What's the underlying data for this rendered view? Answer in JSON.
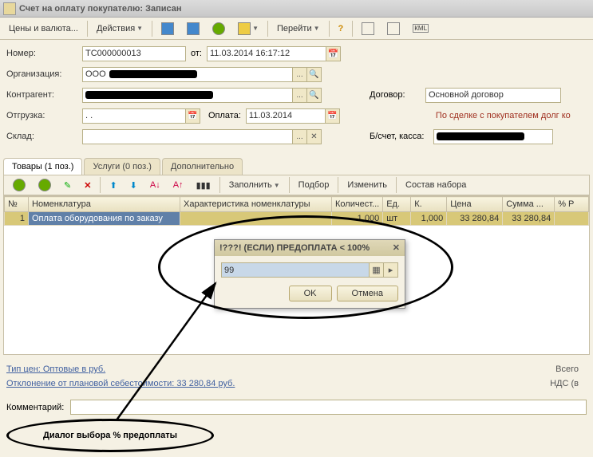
{
  "window": {
    "title": "Счет на оплату покупателю: Записан"
  },
  "toolbar": {
    "prices": "Цены и валюта...",
    "actions": "Действия",
    "go": "Перейти"
  },
  "form": {
    "number_label": "Номер:",
    "number": "ТС000000013",
    "from_label": "от:",
    "date": "11.03.2014 16:17:12",
    "org_label": "Организация:",
    "org": "ООО",
    "contractor_label": "Контрагент:",
    "contract_label": "Договор:",
    "contract": "Основной договор",
    "shipment_label": "Отгрузка:",
    "shipment": ". .",
    "payment_label": "Оплата:",
    "payment_date": "11.03.2014",
    "debt_note": "По сделке с покупателем долг ко",
    "warehouse_label": "Склад:",
    "account_label": "Б/счет, касса:"
  },
  "tabs": {
    "goods": "Товары (1 поз.)",
    "services": "Услуги (0 поз.)",
    "additional": "Дополнительно"
  },
  "tabToolbar": {
    "fill": "Заполнить",
    "select": "Подбор",
    "change": "Изменить",
    "composition": "Состав набора"
  },
  "grid": {
    "headers": {
      "n": "№",
      "item": "Номенклатура",
      "char": "Характеристика номенклатуры",
      "qty": "Количест...",
      "unit": "Ед.",
      "k": "К.",
      "price": "Цена",
      "sum": "Сумма ...",
      "pct": "% Р"
    },
    "rows": [
      {
        "n": "1",
        "item": "Оплата оборудования по заказу ",
        "char": "",
        "qty": "1,000",
        "unit": "шт",
        "k": "1,000",
        "price": "33 280,84",
        "sum": "33 280,84",
        "pct": ""
      }
    ]
  },
  "footer": {
    "price_type": "Тип цен: Оптовые в руб.",
    "deviation": "Отклонение от плановой себестоимости: 33 280,84 руб.",
    "total_label": "Всего",
    "vat_label": "НДС (в",
    "comment_label": "Комментарий:"
  },
  "dialog": {
    "title": "!???! (ЕСЛИ) ПРЕДОПЛАТА < 100%",
    "value": "99",
    "ok": "OK",
    "cancel": "Отмена"
  },
  "annotation": {
    "text": "Диалог выбора % предоплаты"
  }
}
